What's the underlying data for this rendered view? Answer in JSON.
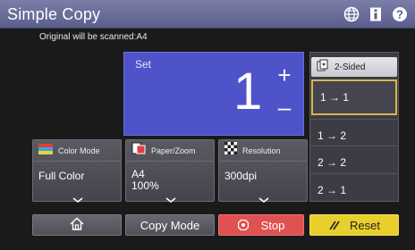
{
  "header": {
    "title": "Simple Copy",
    "icons": [
      "globe-icon",
      "info-icon",
      "help-icon"
    ]
  },
  "original_note": "Original will be scanned:A4",
  "set_panel": {
    "label": "Set",
    "count": "1",
    "plus": "+",
    "minus": "–"
  },
  "sided": {
    "header_label": "2-Sided",
    "options": [
      "1 → 1",
      "1 → 2",
      "2 → 2",
      "2 → 1"
    ],
    "selected": "1 → 1"
  },
  "functions": {
    "color_mode": {
      "label": "Color Mode",
      "value": "Full Color"
    },
    "paper_zoom": {
      "label": "Paper/Zoom",
      "value_line1": "A4",
      "value_line2": "100%"
    },
    "resolution": {
      "label": "Resolution",
      "value": "300dpi"
    }
  },
  "bottom": {
    "copy_mode": "Copy Mode",
    "stop": "Stop",
    "reset": "Reset"
  },
  "colors": {
    "set_panel": "#4f53c9",
    "selected_border": "#d9b64a",
    "stop": "#e05252",
    "reset": "#e8cf2c",
    "title_bar": "#6e719c"
  }
}
